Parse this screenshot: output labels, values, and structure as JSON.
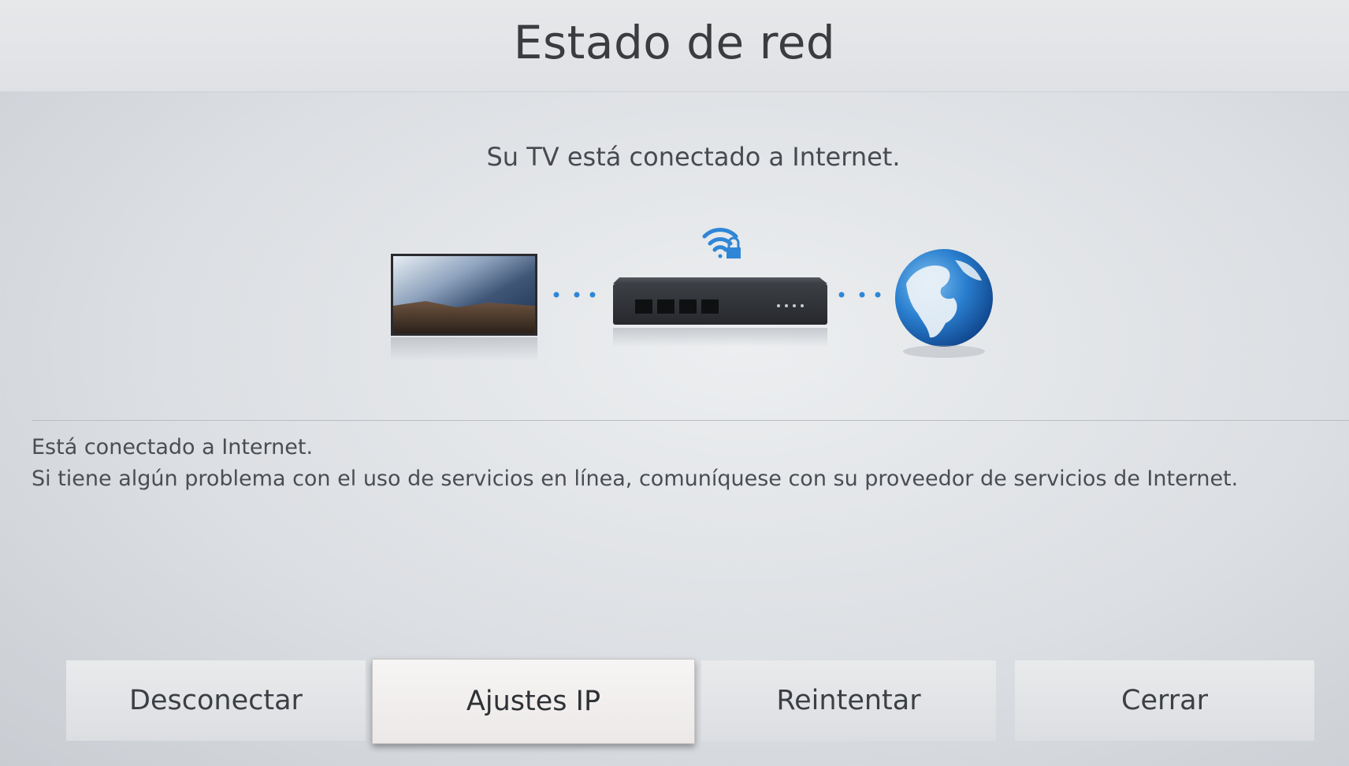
{
  "header": {
    "title": "Estado de red"
  },
  "status": {
    "message": "Su TV está conectado a Internet."
  },
  "diagram": {
    "devices": [
      "tv-icon",
      "router-icon",
      "globe-icon"
    ],
    "wifi": "wifi-lock-icon",
    "connector_color": "#2f86d6"
  },
  "info": {
    "line1": "Está conectado a Internet.",
    "line2": "Si tiene algún problema con el uso de servicios en línea, comuníquese con su proveedor de servicios de Internet."
  },
  "buttons": {
    "disconnect": "Desconectar",
    "ip_settings": "Ajustes IP",
    "retry": "Reintentar",
    "close": "Cerrar"
  }
}
